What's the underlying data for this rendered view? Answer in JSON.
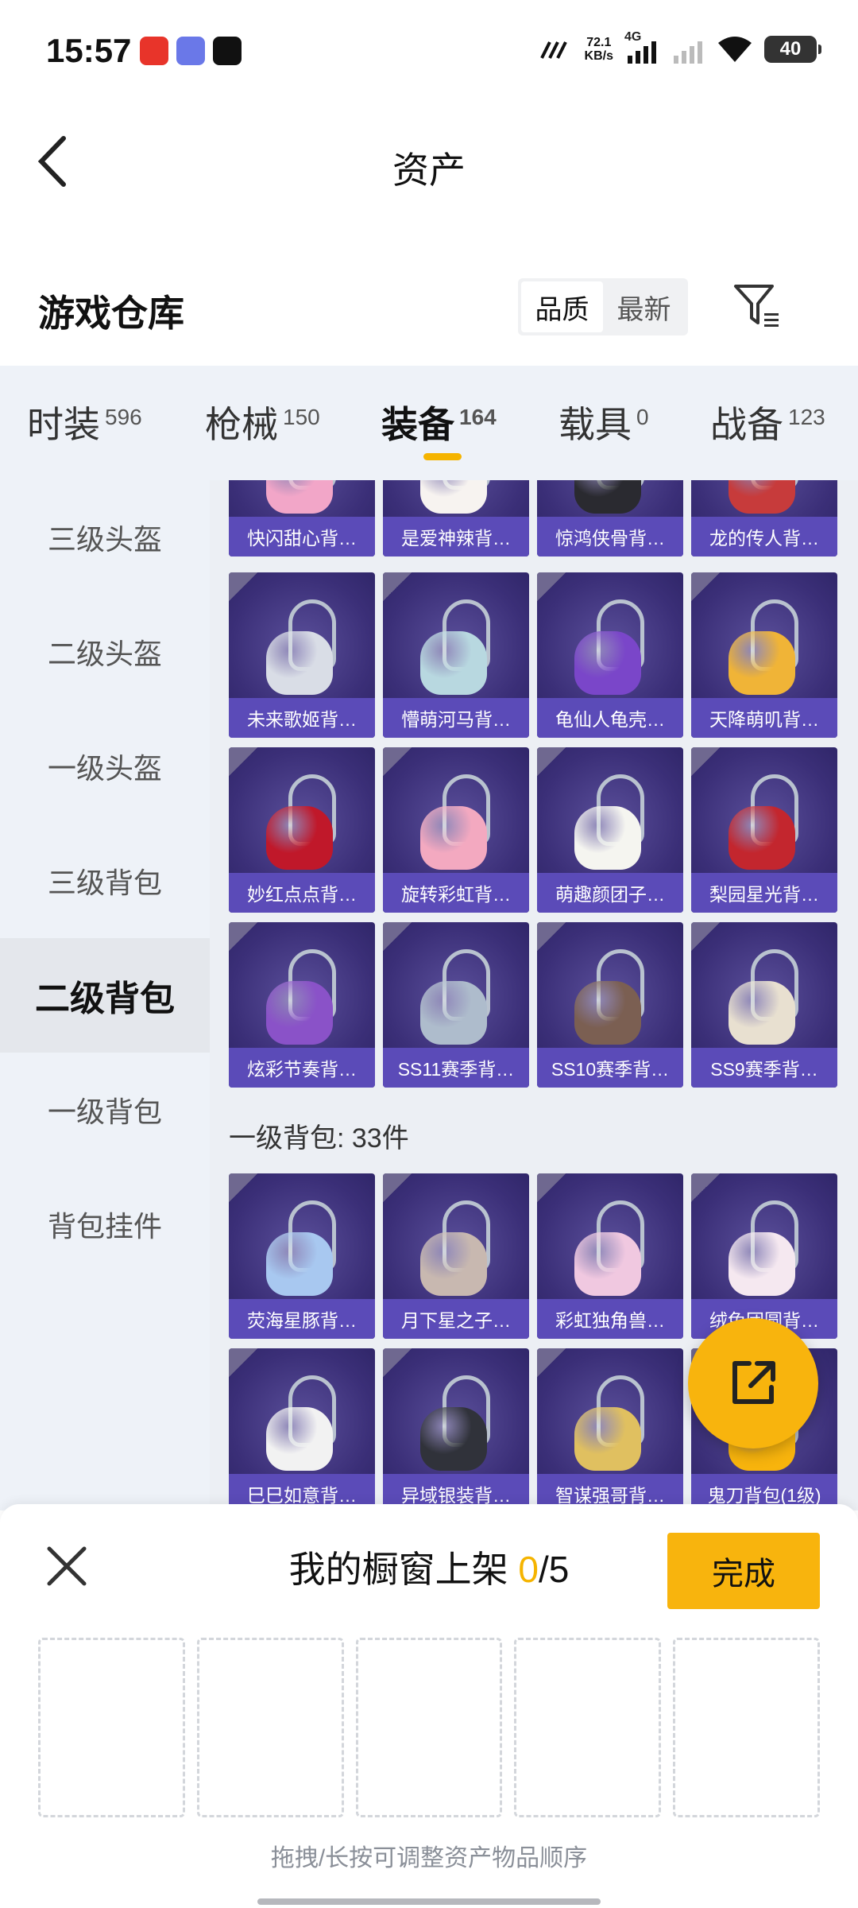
{
  "status_bar": {
    "time": "15:57",
    "net_speed_value": "72.1",
    "net_speed_unit": "KB/s",
    "network": "4G",
    "battery": "40",
    "icons": [
      "netease-music-icon",
      "app-icon",
      "tiktok-icon",
      "signal-icon",
      "wifi-icon",
      "battery-icon"
    ]
  },
  "header": {
    "title": "资产"
  },
  "warehouse": {
    "title": "游戏仓库",
    "sort_options": [
      "品质",
      "最新"
    ],
    "selected_sort": "品质"
  },
  "tabs": [
    {
      "label": "时装",
      "count": "596"
    },
    {
      "label": "枪械",
      "count": "150"
    },
    {
      "label": "装备",
      "count": "164",
      "active": true
    },
    {
      "label": "载具",
      "count": "0"
    },
    {
      "label": "战备",
      "count": "123"
    }
  ],
  "sidebar": {
    "items": [
      {
        "label": "三级头盔"
      },
      {
        "label": "二级头盔"
      },
      {
        "label": "一级头盔"
      },
      {
        "label": "三级背包"
      },
      {
        "label": "二级背包",
        "active": true
      },
      {
        "label": "一级背包"
      },
      {
        "label": "背包挂件"
      }
    ]
  },
  "grid": {
    "rows_top": [
      [
        "快闪甜心背…",
        "是爱神辣背…",
        "惊鸿侠骨背…",
        "龙的传人背…"
      ],
      [
        "未来歌姬背…",
        "懵萌河马背…",
        "龟仙人龟壳…",
        "天降萌叽背…"
      ],
      [
        "妙红点点背…",
        "旋转彩虹背…",
        "萌趣颜团子…",
        "梨园星光背…"
      ],
      [
        "炫彩节奏背…",
        "SS11赛季背…",
        "SS10赛季背…",
        "SS9赛季背…"
      ]
    ],
    "section_title": "一级背包: 33件",
    "rows_bottom": [
      [
        "荧海星豚背…",
        "月下星之子…",
        "彩虹独角兽…",
        "绒兔团圆背…"
      ],
      [
        "巳巳如意背…",
        "异域银装背…",
        "智谋强哥背…",
        "鬼刀背包(1级)"
      ]
    ],
    "colors": {
      "row_top_0": [
        "#f2a6c8",
        "#f7f3f0",
        "#2a2a30",
        "#c73b3b"
      ],
      "row_top_1": [
        "#d9dde6",
        "#b8d8e0",
        "#7a46c9",
        "#f0b437"
      ],
      "row_top_2": [
        "#c0182a",
        "#f3a9c0",
        "#f5f5f0",
        "#c3262e"
      ],
      "row_top_3": [
        "#8a52c8",
        "#aebccc",
        "#7b5f52",
        "#e8e0d0"
      ],
      "row_bot_0": [
        "#a8c8f0",
        "#c8b8b0",
        "#f0c8e0",
        "#f5e8f0"
      ],
      "row_bot_1": [
        "#f2f2f2",
        "#30323a",
        "#e0c060",
        "#f8b40d"
      ]
    }
  },
  "share_fab": {
    "icon": "share-icon"
  },
  "sheet": {
    "title_prefix": "我的橱窗上架",
    "count": "0",
    "total": "/5",
    "done_label": "完成",
    "hint": "拖拽/长按可调整资产物品顺序"
  }
}
